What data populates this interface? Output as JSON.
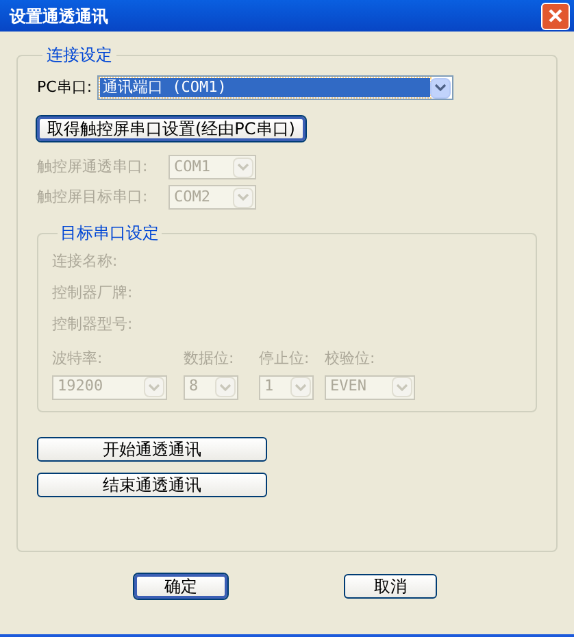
{
  "window": {
    "title": "设置通透通讯"
  },
  "connection_group": {
    "legend": "连接设定",
    "pc_port": {
      "label": "PC串口:",
      "value": "通讯端口 (COM1)",
      "selected": true
    },
    "fetch_button": {
      "label": "取得触控屏串口设置(经由PC串口)",
      "focused": true
    },
    "ports": [
      {
        "label": "触控屏通透串口:",
        "value": "COM1",
        "disabled": true
      },
      {
        "label": "触控屏目标串口:",
        "value": "COM2",
        "disabled": true
      }
    ],
    "target_group": {
      "legend": "目标串口设定",
      "info": [
        {
          "label": "连接名称:",
          "disabled": true
        },
        {
          "label": "控制器厂牌:",
          "disabled": true
        },
        {
          "label": "控制器型号:",
          "disabled": true
        }
      ],
      "settings": [
        {
          "label": "波特率:",
          "value": "19200",
          "disabled": true
        },
        {
          "label": "数据位:",
          "value": "8",
          "disabled": true
        },
        {
          "label": "停止位:",
          "value": "1",
          "disabled": true
        },
        {
          "label": "校验位:",
          "value": "EVEN",
          "disabled": true
        }
      ]
    },
    "actions": [
      {
        "label": "开始通透通讯"
      },
      {
        "label": "结束通透通讯"
      }
    ]
  },
  "buttons": [
    {
      "label": "确定",
      "default": true
    },
    {
      "label": "取消",
      "default": false
    }
  ]
}
